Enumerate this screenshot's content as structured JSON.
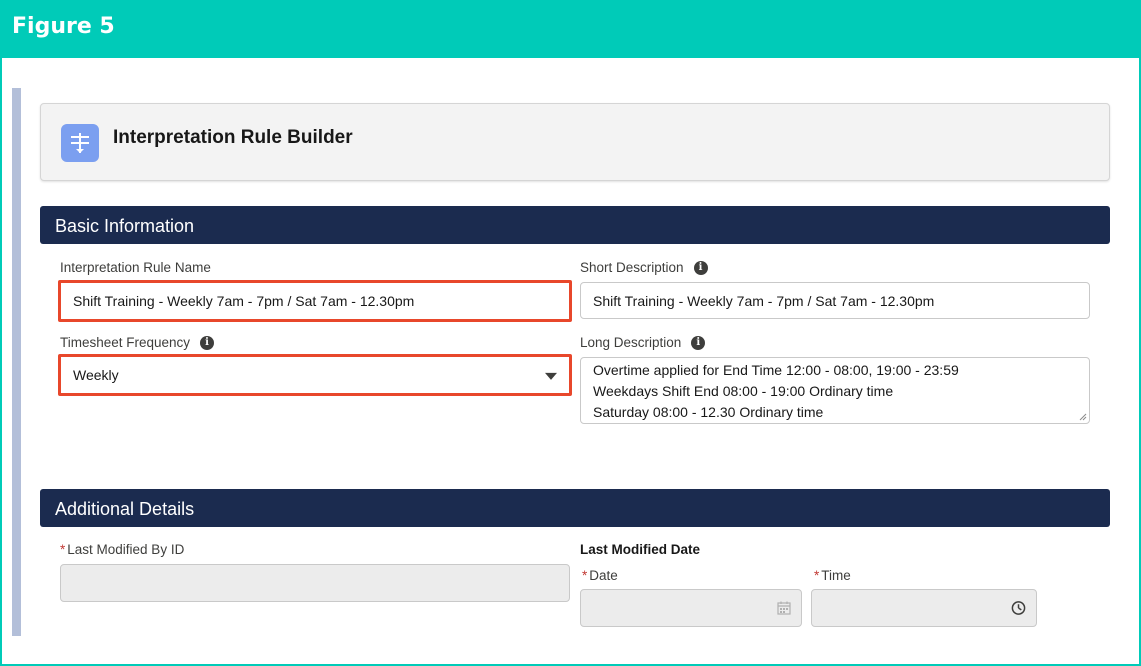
{
  "figure": {
    "title": "Figure 5"
  },
  "builder": {
    "title": "Interpretation Rule Builder",
    "icon": "rule-builder-icon"
  },
  "basic_info": {
    "section_title": "Basic Information",
    "rule_name_label": "Interpretation Rule Name",
    "rule_name_value": "Shift Training - Weekly 7am - 7pm / Sat 7am - 12.30pm",
    "short_desc_label": "Short Description",
    "short_desc_value": "Shift Training - Weekly 7am - 7pm / Sat 7am - 12.30pm",
    "frequency_label": "Timesheet Frequency",
    "frequency_value": "Weekly",
    "long_desc_label": "Long Description",
    "long_desc_lines": [
      "Overtime applied for End Time 12:00 - 08:00, 19:00 - 23:59",
      "Weekdays Shift End 08:00 - 19:00 Ordinary time",
      "Saturday 08:00 - 12.30 Ordinary time"
    ]
  },
  "additional": {
    "section_title": "Additional Details",
    "required_mark": "*",
    "last_modified_by_label": "Last Modified By ID",
    "last_modified_date_label": "Last Modified Date",
    "date_label": "Date",
    "time_label": "Time"
  },
  "colors": {
    "accent": "#00cbb8",
    "section_bar": "#1b2b4f",
    "highlight": "#e8472b",
    "icon_bg": "#7b9ff0"
  }
}
